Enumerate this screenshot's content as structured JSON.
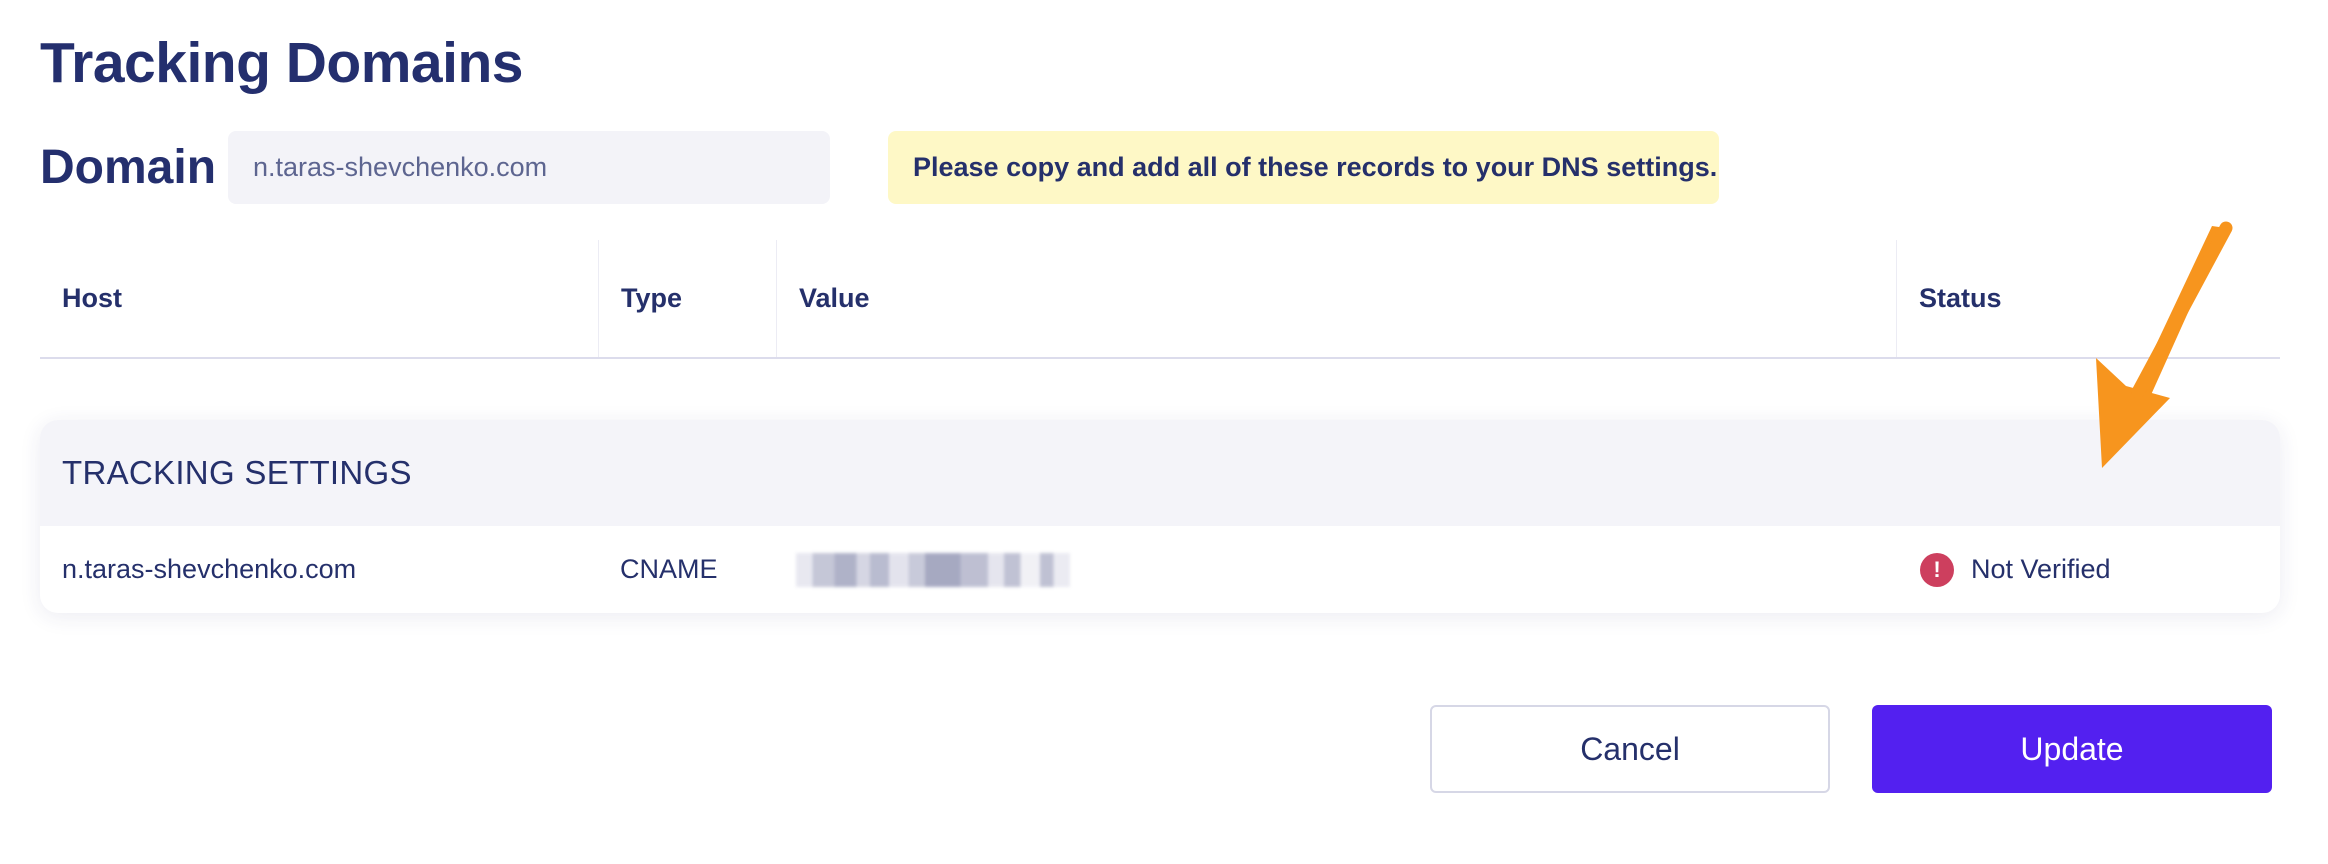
{
  "page": {
    "title": "Tracking Domains"
  },
  "domain": {
    "label": "Domain",
    "value": "n.taras-shevchenko.com"
  },
  "notice": {
    "text": "Please copy and add all of these records to your DNS settings."
  },
  "table": {
    "columns": [
      "Host",
      "Type",
      "Value",
      "Status"
    ]
  },
  "tracking_settings": {
    "heading": "TRACKING SETTINGS",
    "rows": [
      {
        "host": "n.taras-shevchenko.com",
        "type": "CNAME",
        "value_redacted": true,
        "status": "Not Verified",
        "status_icon": "exclamation-circle-icon",
        "status_glyph": "!",
        "status_color": "#cd3f5e"
      }
    ]
  },
  "annotation": {
    "arrow_color": "#f7951e",
    "arrow_icon": "annotation-arrow-icon"
  },
  "actions": {
    "cancel_label": "Cancel",
    "update_label": "Update"
  },
  "colors": {
    "primary": "#5320f0",
    "text": "#25306b",
    "notice_bg": "#fef8c6"
  }
}
